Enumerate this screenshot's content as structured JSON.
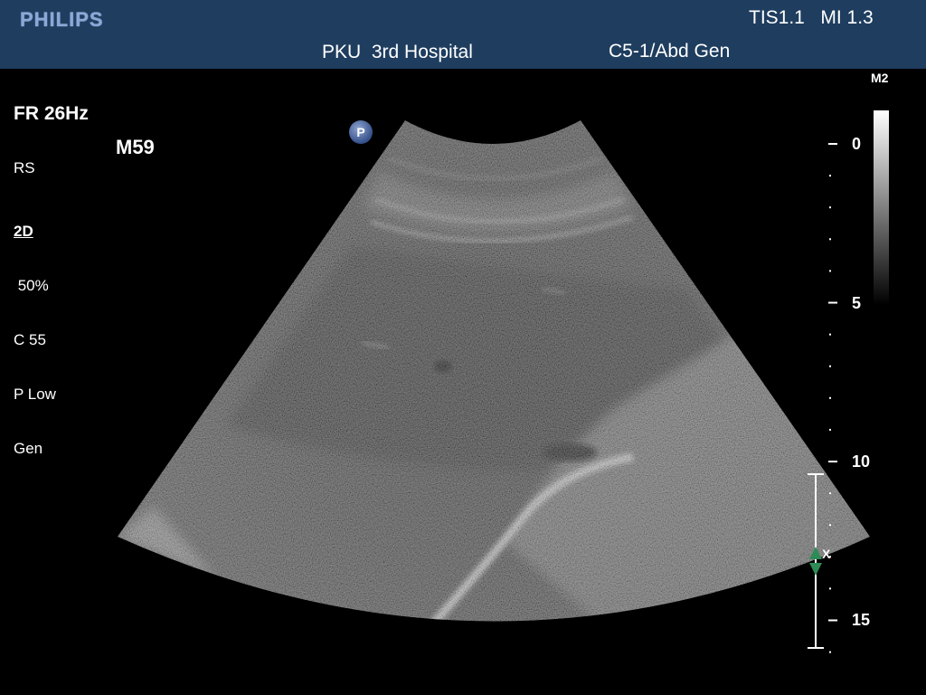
{
  "header": {
    "logo": "PHILIPS",
    "hospital": "PKU  3rd Hospital",
    "preset": "C5-1/Abd Gen",
    "indices": "TIS1.1   MI 1.3"
  },
  "params": {
    "frame_rate": "FR 26Hz",
    "rs": "RS",
    "mode": "2D",
    "gain": " 50%",
    "compression": "C 55",
    "power": "P Low",
    "gen": "Gen"
  },
  "marker": "M59",
  "map_label": "M2",
  "orientation_mark": "P",
  "depth_labels": [
    "0",
    "5",
    "10",
    "15"
  ],
  "focus_label": "X",
  "colors": {
    "header_bg": "#1e3d5f",
    "logo": "#8aa8d8",
    "focus_marker": "#2e8b57"
  }
}
